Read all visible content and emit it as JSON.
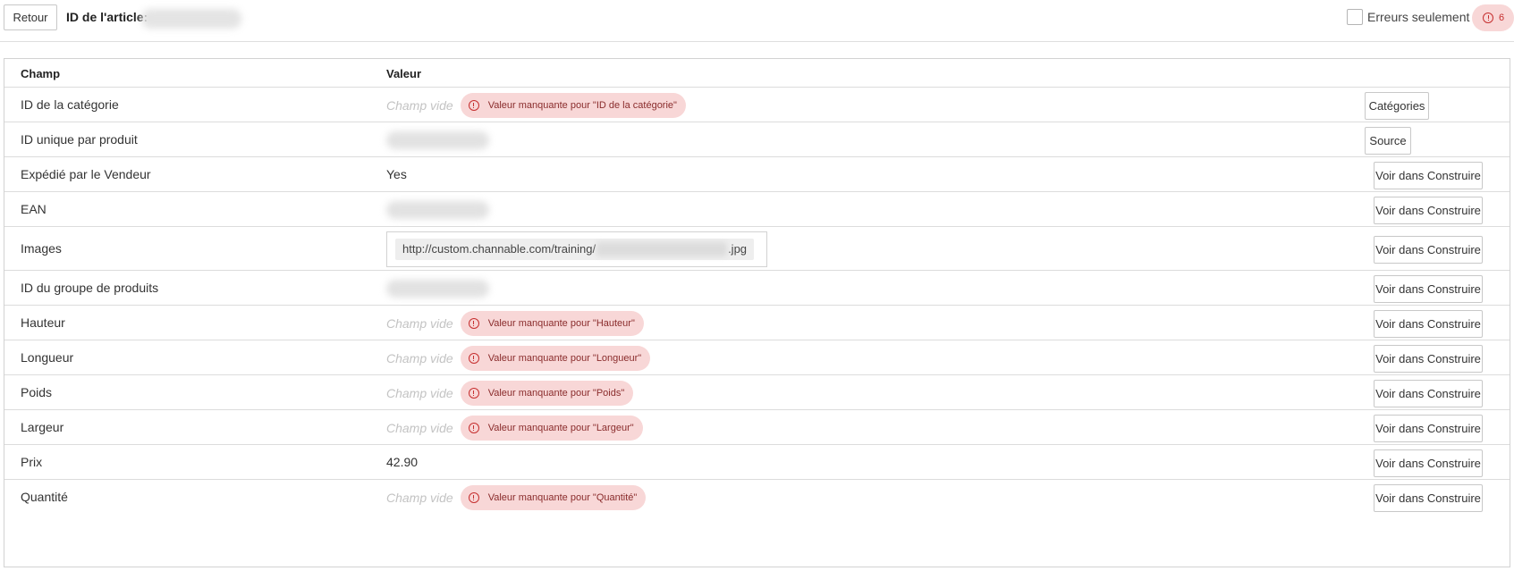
{
  "header": {
    "back_label": "Retour",
    "article_label": "ID de l'article:",
    "errors_only_label": "Erreurs seulement",
    "error_count": "6"
  },
  "table": {
    "columns": {
      "field": "Champ",
      "value": "Valeur"
    },
    "empty_text": "Champ vide",
    "rows": [
      {
        "field": "ID de la catégorie",
        "type": "error",
        "error": "Valeur manquante pour \"ID de la catégorie\"",
        "action": "Catégories"
      },
      {
        "field": "ID unique par produit",
        "type": "blurred",
        "action": "Source"
      },
      {
        "field": "Expédié par le Vendeur",
        "type": "text",
        "value": "Yes",
        "action": "Voir dans Construire"
      },
      {
        "field": "EAN",
        "type": "blurred",
        "action": "Voir dans Construire"
      },
      {
        "field": "Images",
        "type": "image",
        "url_prefix": "http://custom.channable.com/training/",
        "url_suffix": ".jpg",
        "action": "Voir dans Construire"
      },
      {
        "field": "ID du groupe de produits",
        "type": "blurred",
        "action": "Voir dans Construire"
      },
      {
        "field": "Hauteur",
        "type": "error",
        "error": "Valeur manquante pour \"Hauteur\"",
        "action": "Voir dans Construire"
      },
      {
        "field": "Longueur",
        "type": "error",
        "error": "Valeur manquante pour \"Longueur\"",
        "action": "Voir dans Construire"
      },
      {
        "field": "Poids",
        "type": "error",
        "error": "Valeur manquante pour \"Poids\"",
        "action": "Voir dans Construire"
      },
      {
        "field": "Largeur",
        "type": "error",
        "error": "Valeur manquante pour \"Largeur\"",
        "action": "Voir dans Construire"
      },
      {
        "field": "Prix",
        "type": "text",
        "value": "42.90",
        "action": "Voir dans Construire"
      },
      {
        "field": "Quantité",
        "type": "error",
        "error": "Valeur manquante pour \"Quantité\"",
        "action": "Voir dans Construire"
      }
    ]
  },
  "icons": {
    "error": "warning-circle-icon",
    "checkbox": "checkbox-unchecked"
  },
  "colors": {
    "error_bg": "#f8d7d7",
    "error_fg": "#c62f2f"
  }
}
